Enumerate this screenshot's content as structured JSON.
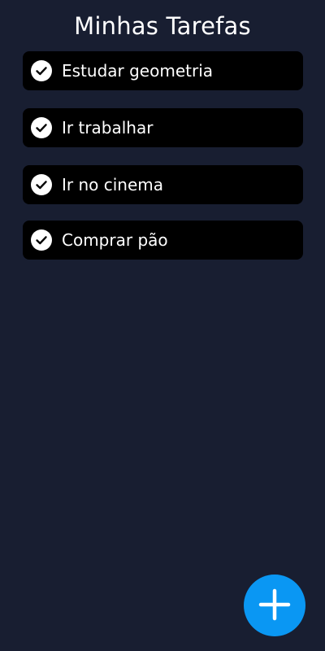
{
  "header": {
    "title": "Minhas Tarefas"
  },
  "tasks": [
    {
      "label": "Estudar geometria",
      "icon": "check-circle-icon",
      "done": true
    },
    {
      "label": "Ir trabalhar",
      "icon": "check-circle-icon",
      "done": true
    },
    {
      "label": "Ir no cinema",
      "icon": "check-circle-icon",
      "done": true
    },
    {
      "label": "Comprar pão",
      "icon": "check-circle-icon",
      "done": true
    }
  ],
  "fab": {
    "icon": "plus-icon"
  },
  "colors": {
    "background": "#181e31",
    "card": "#000000",
    "accent": "#0a97f3",
    "text": "#ffffff"
  }
}
